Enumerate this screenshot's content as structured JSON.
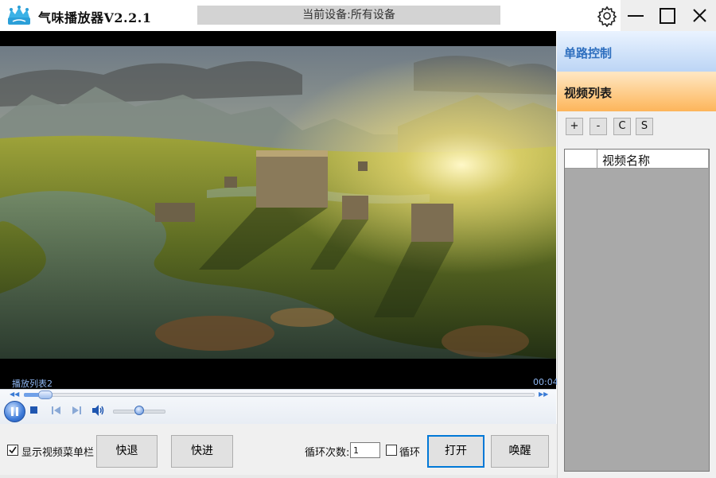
{
  "app": {
    "title": "气味播放器V2.2.1",
    "device_text": "当前设备:所有设备"
  },
  "window_controls": {
    "settings_icon": "gear-icon",
    "minimize_icon": "minimize-icon",
    "maximize_icon": "maximize-icon",
    "close_icon": "close-icon"
  },
  "player": {
    "playlist_label": "播放列表2",
    "time": "00:04",
    "progress_fraction": 0.04,
    "volume_fraction": 0.5
  },
  "bottom": {
    "show_menu_label": "显示视频菜单栏",
    "show_menu_checked": true,
    "rewind_label": "快退",
    "forward_label": "快进",
    "loop_count_label": "循环次数:",
    "loop_count_value": "1",
    "loop_label": "循环",
    "loop_checked": false,
    "open_label": "打开",
    "wake_label": "唤醒"
  },
  "sidebar": {
    "tab_single": "单路控制",
    "tab_list": "视频列表",
    "buttons": [
      "+",
      "-",
      "C",
      "S"
    ],
    "list_header": "视频名称"
  },
  "colors": {
    "accent_blue": "#2f6fbf",
    "tab_orange": "#fdb55a",
    "label_blue": "#8fb7f2"
  }
}
